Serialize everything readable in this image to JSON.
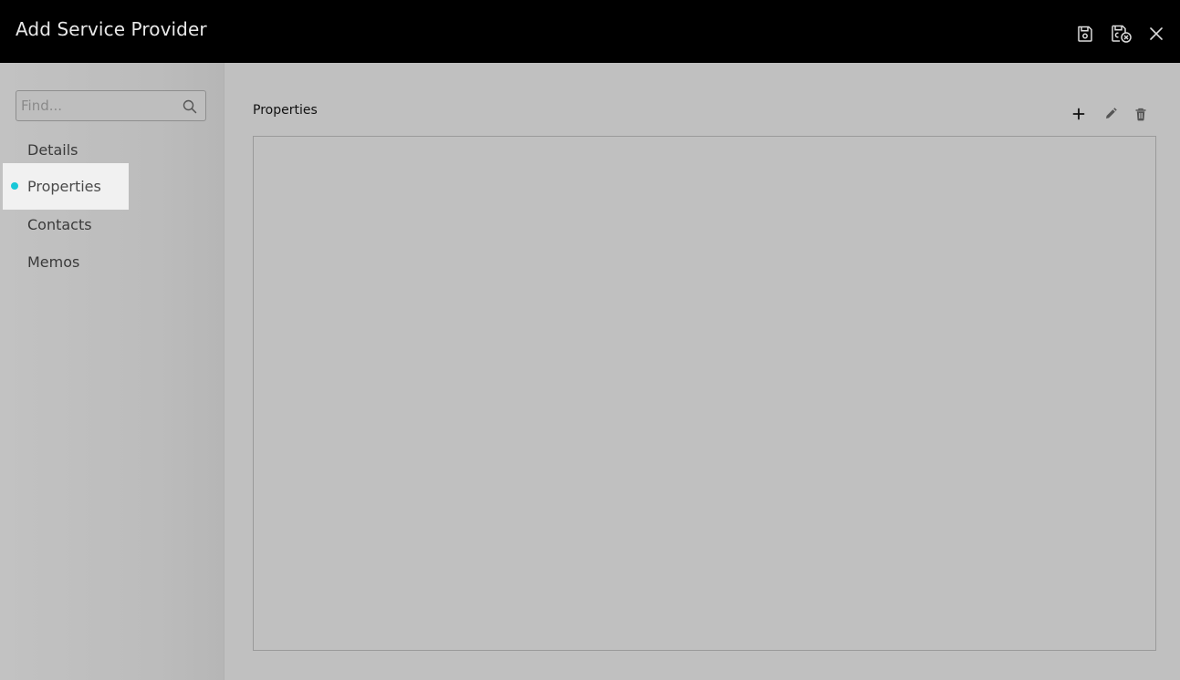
{
  "header": {
    "title": "Add Service Provider",
    "icons": {
      "save": "save-icon",
      "save_close": "save-close-icon",
      "close": "close-icon"
    }
  },
  "sidebar": {
    "search": {
      "placeholder": "Find...",
      "value": ""
    },
    "items": [
      {
        "label": "Details",
        "active": false
      },
      {
        "label": "Properties",
        "active": true
      },
      {
        "label": "Contacts",
        "active": false
      },
      {
        "label": "Memos",
        "active": false
      }
    ]
  },
  "main": {
    "section_title": "Properties",
    "toolbar": {
      "add": "plus-icon",
      "edit": "pencil-icon",
      "delete": "trash-icon"
    }
  },
  "colors": {
    "header_bg": "#000000",
    "body_bg": "#c0c0c0",
    "active_item_bg": "#f1f1f1",
    "accent_dot": "#18c8d8"
  }
}
